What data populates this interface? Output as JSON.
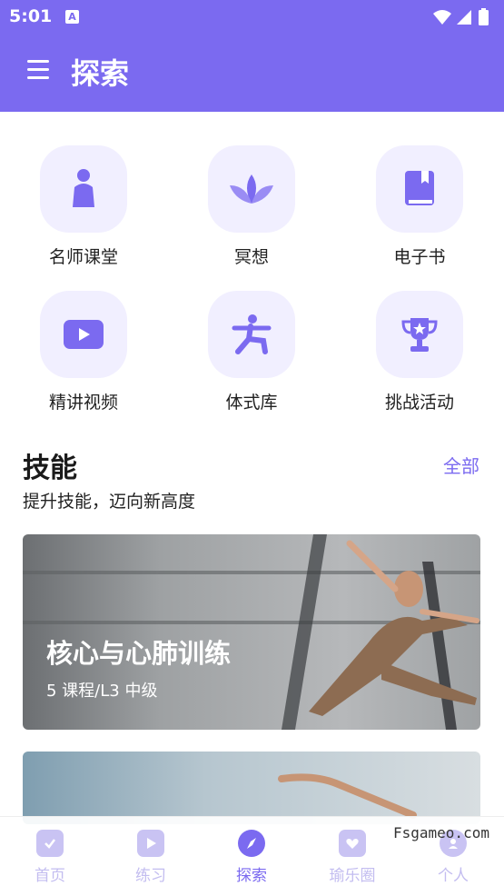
{
  "status": {
    "time": "5:01",
    "a_badge": "A"
  },
  "appbar": {
    "title": "探索"
  },
  "categories": [
    {
      "label": "名师课堂",
      "icon": "teacher-icon"
    },
    {
      "label": "冥想",
      "icon": "lotus-icon"
    },
    {
      "label": "电子书",
      "icon": "book-icon"
    },
    {
      "label": "精讲视频",
      "icon": "play-video-icon"
    },
    {
      "label": "体式库",
      "icon": "yoga-pose-icon"
    },
    {
      "label": "挑战活动",
      "icon": "trophy-icon"
    }
  ],
  "skills": {
    "title": "技能",
    "subtitle": "提升技能，迈向新高度",
    "all_label": "全部",
    "cards": [
      {
        "title": "核心与心肺训练",
        "subtitle": "5 课程/L3 中级"
      },
      {
        "title": "",
        "subtitle": ""
      }
    ]
  },
  "bottom_nav": [
    {
      "label": "首页",
      "icon": "calendar-icon",
      "active": false
    },
    {
      "label": "练习",
      "icon": "play-icon",
      "active": false
    },
    {
      "label": "探索",
      "icon": "compass-icon",
      "active": true
    },
    {
      "label": "瑜乐圈",
      "icon": "heart-chat-icon",
      "active": false
    },
    {
      "label": "个人",
      "icon": "profile-icon",
      "active": false
    }
  ],
  "watermark": "Fsgameo.com",
  "colors": {
    "primary": "#7b6af0",
    "tile_bg": "#f1efff",
    "nav_inactive": "#c3bdf0"
  }
}
